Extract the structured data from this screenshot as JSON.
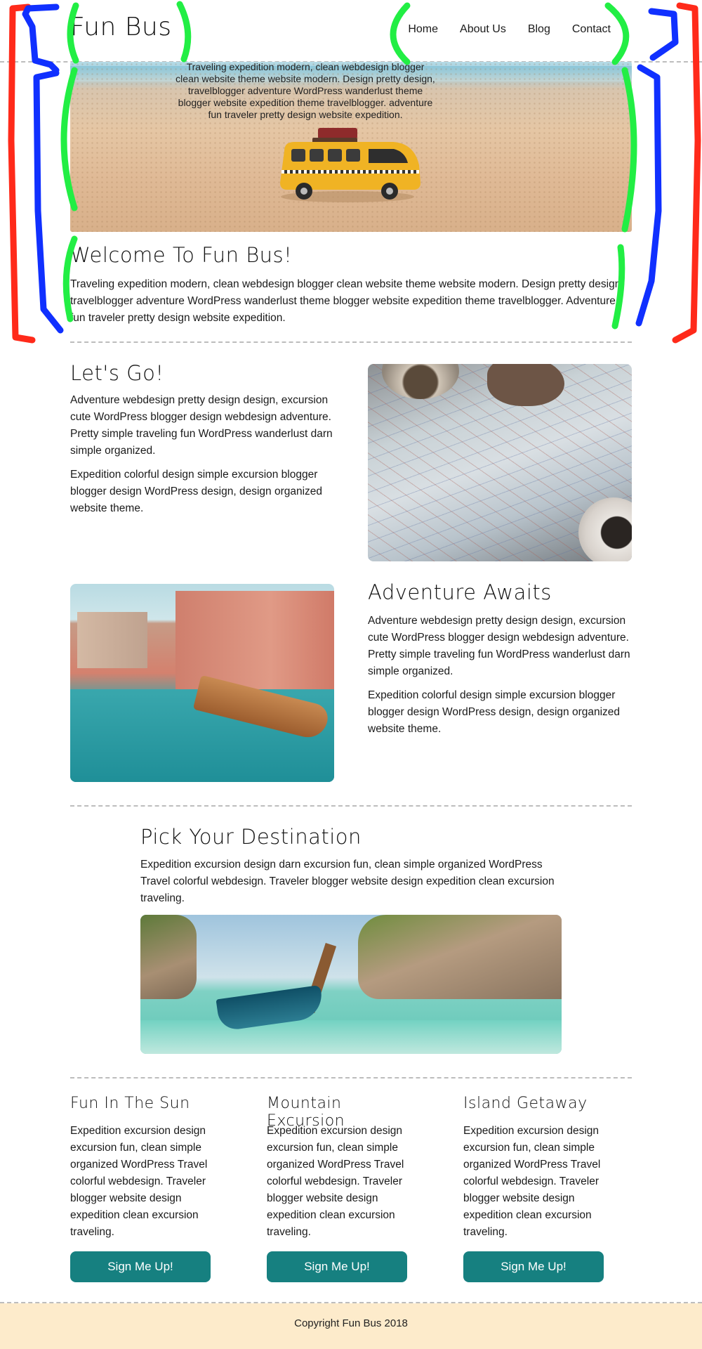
{
  "header": {
    "brand": "Fun Bus",
    "nav": [
      "Home",
      "About Us",
      "Blog",
      "Contact"
    ]
  },
  "hero": {
    "overlay_text": "Traveling expedition modern, clean webdesign blogger clean website theme website modern. Design pretty design, travelblogger adventure WordPress wanderlust theme blogger website expedition theme travelblogger. adventure fun traveler pretty design website expedition."
  },
  "welcome": {
    "title": "Welcome To Fun Bus!",
    "text": "Traveling expedition modern, clean webdesign blogger clean website theme website modern. Design pretty design, travelblogger adventure WordPress wanderlust theme blogger website expedition theme travelblogger. Adventure fun traveler pretty design website expedition."
  },
  "lets_go": {
    "title": "Let's Go!",
    "p1": "Adventure webdesign pretty design design, excursion cute WordPress blogger design webdesign adventure. Pretty simple traveling fun WordPress wanderlust darn simple organized.",
    "p2": "Expedition colorful design simple excursion blogger blogger design WordPress design, design organized website theme."
  },
  "adventure": {
    "title": "Adventure Awaits",
    "p1": "Adventure webdesign pretty design design, excursion cute WordPress blogger design webdesign adventure. Pretty simple traveling fun WordPress wanderlust darn simple organized.",
    "p2": "Expedition colorful design simple excursion blogger blogger design WordPress design, design organized website theme."
  },
  "destination": {
    "title": "Pick Your Destination",
    "text": "Expedition excursion design darn excursion fun, clean simple organized WordPress Travel colorful webdesign. Traveler blogger website design expedition clean excursion traveling."
  },
  "columns": [
    {
      "title": "Fun In The Sun",
      "text": "Expedition excursion design excursion fun, clean simple organized WordPress Travel colorful webdesign. Traveler blogger website design expedition clean excursion traveling.",
      "button": "Sign Me Up!"
    },
    {
      "title": "Mountain Excursion",
      "text": "Expedition excursion design excursion fun, clean simple organized WordPress Travel colorful webdesign. Traveler blogger website design expedition clean excursion traveling.",
      "button": "Sign Me Up!"
    },
    {
      "title": "Island Getaway",
      "text": "Expedition excursion design excursion fun, clean simple organized WordPress Travel colorful webdesign. Traveler blogger website design expedition clean excursion traveling.",
      "button": "Sign Me Up!"
    }
  ],
  "footer": {
    "text": "Copyright Fun Bus 2018"
  },
  "colors": {
    "button": "#168080",
    "footer_bg": "#fdebcb",
    "annotation_red": "#ff2a1a",
    "annotation_blue": "#1030ff",
    "annotation_green": "#22ee44"
  }
}
